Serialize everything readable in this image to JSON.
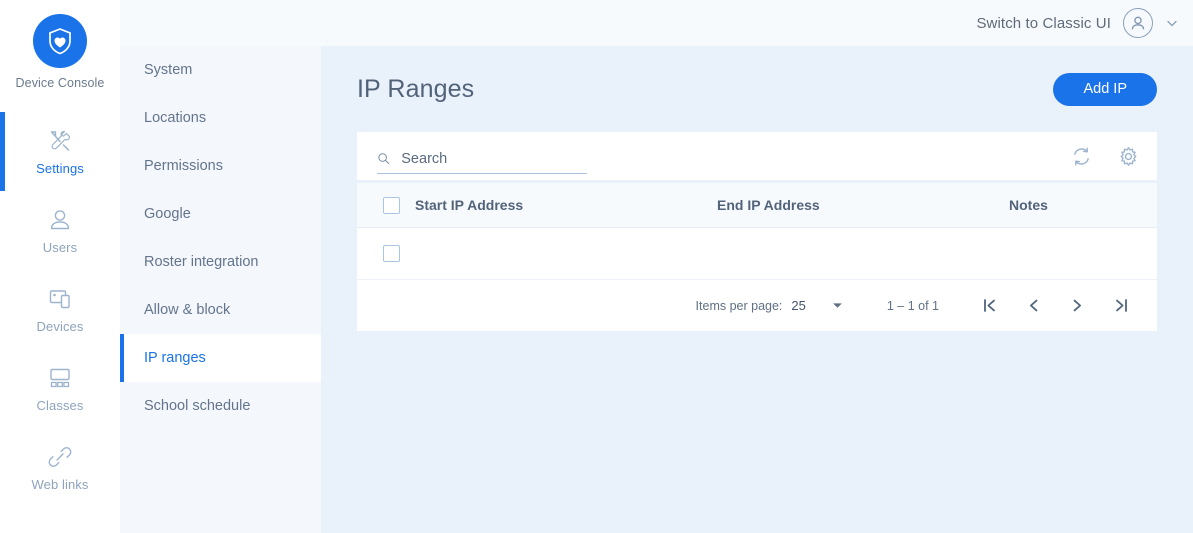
{
  "brand": {
    "logo_icon": "shield-heart-icon",
    "name": "Device Console",
    "accent_color": "#1a73e8"
  },
  "rail": {
    "items": [
      {
        "label": "Settings",
        "icon": "tools-icon",
        "active": true
      },
      {
        "label": "Users",
        "icon": "user-icon",
        "active": false
      },
      {
        "label": "Devices",
        "icon": "devices-icon",
        "active": false
      },
      {
        "label": "Classes",
        "icon": "classes-icon",
        "active": false
      },
      {
        "label": "Web links",
        "icon": "link-icon",
        "active": false
      }
    ]
  },
  "subnav": {
    "items": [
      {
        "label": "System",
        "active": false
      },
      {
        "label": "Locations",
        "active": false
      },
      {
        "label": "Permissions",
        "active": false
      },
      {
        "label": "Google",
        "active": false
      },
      {
        "label": "Roster integration",
        "active": false
      },
      {
        "label": "Allow & block",
        "active": false
      },
      {
        "label": "IP ranges",
        "active": true
      },
      {
        "label": "School schedule",
        "active": false
      }
    ]
  },
  "topbar": {
    "switch_label": "Switch to Classic UI",
    "avatar_icon": "user-avatar-icon",
    "chevron_icon": "chevron-down-icon"
  },
  "page": {
    "title": "IP Ranges",
    "add_button": "Add IP"
  },
  "search": {
    "placeholder": "Search",
    "value": "",
    "icon": "search-icon"
  },
  "toolbar": {
    "refresh_icon": "refresh-icon",
    "settings_icon": "gear-icon"
  },
  "table": {
    "columns": [
      "Start IP Address",
      "End IP Address",
      "Notes"
    ],
    "rows": [
      {
        "start_ip": "",
        "end_ip": "",
        "notes": "",
        "redacted": true,
        "selected": false
      }
    ]
  },
  "paginator": {
    "items_per_page_label": "Items per page:",
    "items_per_page_value": "25",
    "range_label": "1 – 1 of 1",
    "first_icon": "first-page-icon",
    "prev_icon": "previous-page-icon",
    "next_icon": "next-page-icon",
    "last_icon": "last-page-icon"
  }
}
